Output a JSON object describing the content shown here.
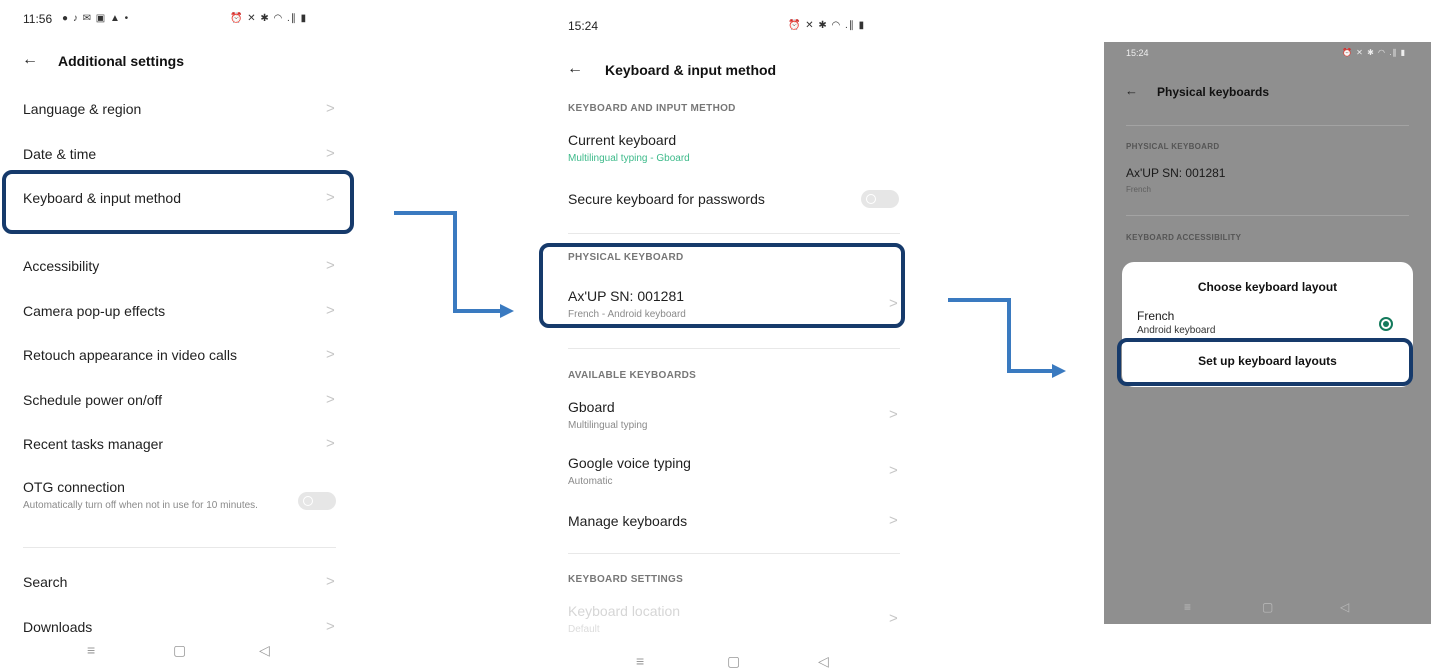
{
  "panel1": {
    "status_time": "11:56",
    "status_left_icons": "● ♪ ✉ ▣ ▲ •",
    "status_right_icons": "⏰ ✕ ✱ ◠ .∥ ▮",
    "title": "Additional settings",
    "back_icon": "←",
    "items": [
      {
        "label": "Language & region"
      },
      {
        "label": "Date & time"
      },
      {
        "label": "Keyboard & input method"
      },
      {
        "label": "Accessibility"
      },
      {
        "label": "Camera pop-up effects"
      },
      {
        "label": "Retouch appearance in video calls"
      },
      {
        "label": "Schedule power on/off"
      },
      {
        "label": "Recent tasks manager"
      },
      {
        "label": "OTG connection",
        "sub": "Automatically turn off when not in use for 10 minutes.",
        "toggle": "off"
      },
      {
        "label": "Search"
      },
      {
        "label": "Downloads"
      }
    ],
    "nav": {
      "menu": "≡",
      "home": "▢",
      "back": "◁"
    }
  },
  "panel2": {
    "status_time": "15:24",
    "status_right_icons": "⏰ ✕ ✱ ◠ .∥ ▮",
    "title": "Keyboard & input method",
    "back_icon": "←",
    "section1": "KEYBOARD AND INPUT METHOD",
    "current_keyboard_label": "Current keyboard",
    "current_keyboard_sub": "Multilingual typing - Gboard",
    "secure_label": "Secure keyboard for passwords",
    "secure_toggle": "off",
    "section2": "PHYSICAL KEYBOARD",
    "physical_label": "Ax'UP SN: 001281",
    "physical_sub": "French - Android keyboard",
    "section3": "AVAILABLE KEYBOARDS",
    "gboard_label": "Gboard",
    "gboard_sub": "Multilingual typing",
    "voice_label": "Google voice typing",
    "voice_sub": "Automatic",
    "manage_label": "Manage keyboards",
    "section4": "KEYBOARD SETTINGS",
    "location_label": "Keyboard location",
    "location_sub": "Default",
    "nav": {
      "menu": "≡",
      "home": "▢",
      "back": "◁"
    }
  },
  "panel3": {
    "status_time": "15:24",
    "status_right_icons": "⏰ ✕ ✱ ◠ .∥ ▮",
    "title": "Physical keyboards",
    "back_icon": "←",
    "section1": "PHYSICAL KEYBOARD",
    "device_label": "Ax'UP SN: 001281",
    "device_sub": "French",
    "section2": "KEYBOARD ACCESSIBILITY",
    "dialog": {
      "title": "Choose keyboard layout",
      "option_label": "French",
      "option_sub": "Android keyboard",
      "setup_button": "Set up keyboard layouts"
    },
    "nav": {
      "menu": "≡",
      "home": "▢",
      "back": "◁"
    }
  },
  "colors": {
    "highlight": "#163a6b",
    "arrow": "#3a7ac0",
    "accent_green": "#3dba8a",
    "radio_green": "#147a5c",
    "dim_overlay": "#8f8f8f"
  }
}
